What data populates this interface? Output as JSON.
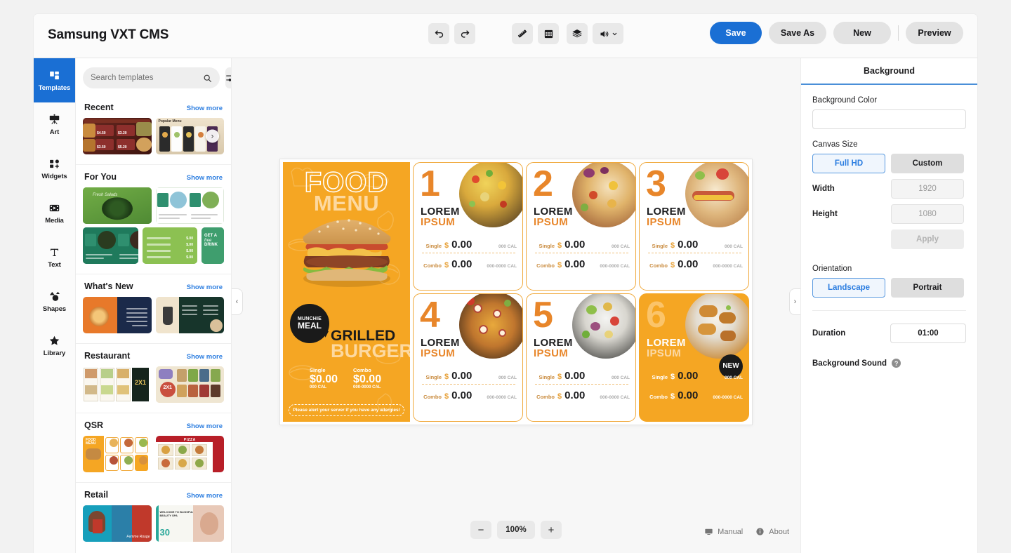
{
  "app": {
    "title": "Samsung VXT CMS"
  },
  "toolbar": {
    "items": [
      {
        "name": "undo-icon",
        "label": "Undo"
      },
      {
        "name": "redo-icon",
        "label": "Redo"
      },
      {
        "name": "ruler-icon",
        "label": "Ruler"
      },
      {
        "name": "grid-icon",
        "label": "Grid"
      },
      {
        "name": "layers-icon",
        "label": "Layers"
      },
      {
        "name": "volume-icon",
        "label": "Volume"
      }
    ],
    "save_label": "Save",
    "save_as_label": "Save As",
    "new_label": "New",
    "preview_label": "Preview"
  },
  "sidebar": {
    "items": [
      {
        "label": "Templates",
        "icon": "templates-icon",
        "active": true
      },
      {
        "label": "Art",
        "icon": "art-icon",
        "active": false
      },
      {
        "label": "Widgets",
        "icon": "widgets-icon",
        "active": false
      },
      {
        "label": "Media",
        "icon": "media-icon",
        "active": false
      },
      {
        "label": "Text",
        "icon": "text-icon",
        "active": false
      },
      {
        "label": "Shapes",
        "icon": "shapes-icon",
        "active": false
      },
      {
        "label": "Library",
        "icon": "library-icon",
        "active": false
      }
    ]
  },
  "templates": {
    "search": {
      "placeholder": "Search templates",
      "value": "",
      "icon": "search-icon"
    },
    "filter_icon": "filter-icon",
    "show_more_label": "Show more",
    "sections": [
      {
        "title": "Recent"
      },
      {
        "title": "For You"
      },
      {
        "title": "What's New"
      },
      {
        "title": "Restaurant"
      },
      {
        "title": "QSR"
      },
      {
        "title": "Retail"
      }
    ],
    "recent_prices": [
      "$4.50",
      "$3.20",
      "$3.50",
      "$5.20"
    ]
  },
  "canvas": {
    "hero": {
      "title_line1": "FOOD",
      "title_line2": "MENU",
      "badge_line1": "MUNCHIE",
      "badge_line2": "MEAL",
      "item_line1": "GRILLED",
      "item_line2": "BURGER",
      "single_label": "Single",
      "single_price": "$0.00",
      "single_cal": "000 CAL",
      "combo_label": "Combo",
      "combo_price": "$0.00",
      "combo_cal": "000-0000 CAL",
      "allergy_note": "Please alert your server if you have any allergies!"
    },
    "items": [
      {
        "number": "1",
        "name1": "LOREM",
        "name2": "IPSUM",
        "single_label": "Single",
        "single_price": "0.00",
        "single_cal": "000 CAL",
        "combo_label": "Combo",
        "combo_price": "0.00",
        "combo_cal": "000-0000 CAL",
        "currency": "$",
        "accent": false,
        "badge": "",
        "photo": "taco"
      },
      {
        "number": "2",
        "name1": "LOREM",
        "name2": "IPSUM",
        "single_label": "Single",
        "single_price": "0.00",
        "single_cal": "000 CAL",
        "combo_label": "Combo",
        "combo_price": "0.00",
        "combo_cal": "000-0000 CAL",
        "currency": "$",
        "accent": false,
        "badge": "",
        "photo": "burrito"
      },
      {
        "number": "3",
        "name1": "LOREM",
        "name2": "IPSUM",
        "single_label": "Single",
        "single_price": "0.00",
        "single_cal": "000 CAL",
        "combo_label": "Combo",
        "combo_price": "0.00",
        "combo_cal": "000-0000 CAL",
        "currency": "$",
        "accent": false,
        "badge": "",
        "photo": "hotdog"
      },
      {
        "number": "4",
        "name1": "LOREM",
        "name2": "IPSUM",
        "single_label": "Single",
        "single_price": "0.00",
        "single_cal": "000 CAL",
        "combo_label": "Combo",
        "combo_price": "0.00",
        "combo_cal": "000-0000 CAL",
        "currency": "$",
        "accent": false,
        "badge": "",
        "photo": "pizza"
      },
      {
        "number": "5",
        "name1": "LOREM",
        "name2": "IPSUM",
        "single_label": "Single",
        "single_price": "0.00",
        "single_cal": "000 CAL",
        "combo_label": "Combo",
        "combo_price": "0.00",
        "combo_cal": "000-0000 CAL",
        "currency": "$",
        "accent": false,
        "badge": "",
        "photo": "salad"
      },
      {
        "number": "6",
        "name1": "LOREM",
        "name2": "IPSUM",
        "single_label": "Single",
        "single_price": "0.00",
        "single_cal": "000 CAL",
        "combo_label": "Combo",
        "combo_price": "0.00",
        "combo_cal": "000-0000 CAL",
        "currency": "$",
        "accent": true,
        "badge": "NEW",
        "photo": "wings"
      }
    ]
  },
  "zoom": {
    "minus": "−",
    "value": "100%",
    "plus": "+"
  },
  "footer": {
    "manual_label": "Manual",
    "manual_icon": "monitor-icon",
    "about_label": "About",
    "about_icon": "info-icon"
  },
  "collapse": {
    "left": "‹",
    "right": "›"
  },
  "properties": {
    "panel_title": "Background",
    "background_color_label": "Background Color",
    "background_color_value": "",
    "canvas_size_label": "Canvas Size",
    "full_hd_label": "Full HD",
    "custom_label": "Custom",
    "width_label": "Width",
    "width_value": "1920",
    "height_label": "Height",
    "height_value": "1080",
    "apply_label": "Apply",
    "orientation_label": "Orientation",
    "landscape_label": "Landscape",
    "portrait_label": "Portrait",
    "duration_label": "Duration",
    "duration_value": "01:00",
    "background_sound_label": "Background Sound",
    "help_glyph": "?"
  },
  "colors": {
    "accent_blue": "#1a6fd4",
    "menu_orange": "#f5a623",
    "number_orange": "#e8862a",
    "link_blue": "#2b7de0"
  }
}
